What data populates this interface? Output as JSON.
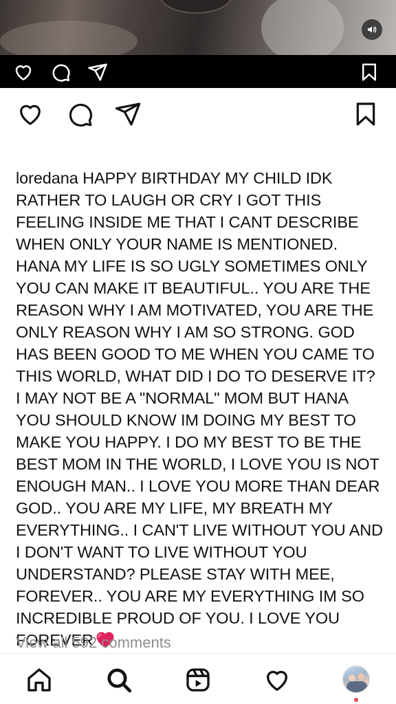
{
  "media": {
    "icons": {
      "mute": "speaker-icon"
    }
  },
  "embedded_actions": {
    "icons": [
      "heart-icon",
      "comment-icon",
      "share-icon",
      "bookmark-icon"
    ]
  },
  "post_actions": {
    "icons": [
      "heart-icon",
      "comment-icon",
      "share-icon",
      "bookmark-icon"
    ]
  },
  "caption": {
    "username": "loredana",
    "text": "HAPPY BIRTHDAY MY CHILD IDK RATHER TO LAUGH OR CRY I GOT THIS FEELING INSIDE ME THAT I CANT DESCRIBE WHEN ONLY YOUR NAME IS MENTIONED. HANA MY LIFE IS SO UGLY SOMETIMES ONLY YOU CAN MAKE IT BEAUTIFUL.. YOU ARE THE REASON WHY I AM MOTIVATED, YOU ARE THE ONLY REASON WHY I AM SO STRONG. GOD HAS BEEN GOOD TO ME WHEN YOU CAME TO THIS WORLD, WHAT DID I DO TO DESERVE IT? I MAY NOT BE A \"NORMAL\" MOM BUT HANA YOU SHOULD KNOW IM DOING MY BEST TO MAKE YOU HAPPY. I DO MY BEST TO BE THE BEST MOM IN THE WORLD, I LOVE YOU IS NOT ENOUGH MAN.. I LOVE YOU MORE THAN DEAR GOD.. YOU ARE MY LIFE, MY BREATH MY EVERYTHING.. I CAN'T LIVE WITHOUT YOU AND I DON'T WANT TO LIVE WITHOUT YOU UNDERSTAND? PLEASE STAY WITH MEE, FOREVER.. YOU ARE MY EVERYTHING IM SO INCREDIBLE PROUD OF YOU. I LOVE YOU FOREVER",
    "emoji": "red-heart-emoji"
  },
  "comments": {
    "view_all": "View all 592 comments"
  },
  "bottom_nav": {
    "items": [
      "home-icon",
      "search-icon",
      "reels-icon",
      "activity-heart-icon",
      "profile-avatar"
    ]
  },
  "colors": {
    "background": "#ffffff",
    "text": "#111111",
    "muted": "#8e8e8e",
    "emoji_red": "#e0245e",
    "notification": "#ed4956"
  }
}
